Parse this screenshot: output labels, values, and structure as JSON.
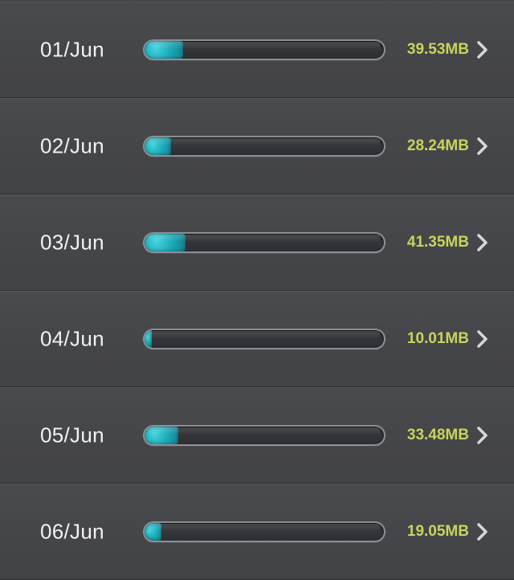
{
  "usage_list": {
    "rows": [
      {
        "date": "01/Jun",
        "size": "39.53MB",
        "usage_fraction": 0.16
      },
      {
        "date": "02/Jun",
        "size": "28.24MB",
        "usage_fraction": 0.11
      },
      {
        "date": "03/Jun",
        "size": "41.35MB",
        "usage_fraction": 0.17
      },
      {
        "date": "04/Jun",
        "size": "10.01MB",
        "usage_fraction": 0.03
      },
      {
        "date": "05/Jun",
        "size": "33.48MB",
        "usage_fraction": 0.14
      },
      {
        "date": "06/Jun",
        "size": "19.05MB",
        "usage_fraction": 0.07
      }
    ]
  },
  "colors": {
    "background": "#45464a",
    "accent_text": "#c9d45b",
    "bar_fill": "#1aa6b4"
  },
  "icons": {
    "chevron": "chevron-right-icon"
  }
}
